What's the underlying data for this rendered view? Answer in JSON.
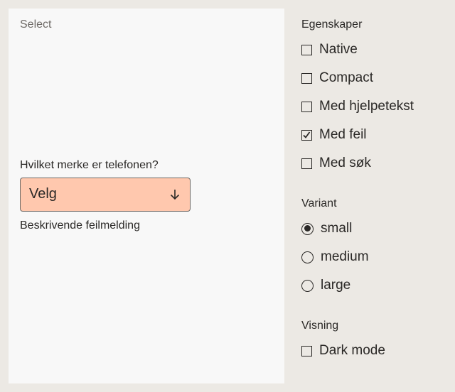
{
  "preview": {
    "title": "Select",
    "select": {
      "label": "Hvilket merke er telefonen?",
      "value": "Velg",
      "error": "Beskrivende feilmelding"
    }
  },
  "panel": {
    "properties": {
      "title": "Egenskaper",
      "items": [
        {
          "label": "Native",
          "checked": false
        },
        {
          "label": "Compact",
          "checked": false
        },
        {
          "label": "Med hjelpetekst",
          "checked": false
        },
        {
          "label": "Med feil",
          "checked": true
        },
        {
          "label": "Med søk",
          "checked": false
        }
      ]
    },
    "variant": {
      "title": "Variant",
      "items": [
        {
          "label": "small",
          "selected": true
        },
        {
          "label": "medium",
          "selected": false
        },
        {
          "label": "large",
          "selected": false
        }
      ]
    },
    "display": {
      "title": "Visning",
      "items": [
        {
          "label": "Dark mode",
          "checked": false
        }
      ]
    }
  },
  "colors": {
    "page_bg": "#ECE9E4",
    "preview_bg": "#F8F8F8",
    "error_select_bg": "#FFC8AE",
    "text": "#2A2826"
  }
}
